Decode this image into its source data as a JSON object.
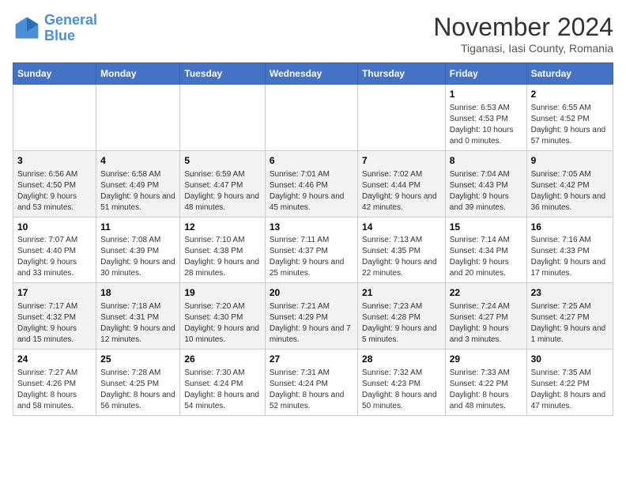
{
  "logo": {
    "line1": "General",
    "line2": "Blue"
  },
  "title": "November 2024",
  "subtitle": "Tiganasi, Iasi County, Romania",
  "days_of_week": [
    "Sunday",
    "Monday",
    "Tuesday",
    "Wednesday",
    "Thursday",
    "Friday",
    "Saturday"
  ],
  "weeks": [
    [
      {
        "day": "",
        "sunrise": "",
        "sunset": "",
        "daylight": ""
      },
      {
        "day": "",
        "sunrise": "",
        "sunset": "",
        "daylight": ""
      },
      {
        "day": "",
        "sunrise": "",
        "sunset": "",
        "daylight": ""
      },
      {
        "day": "",
        "sunrise": "",
        "sunset": "",
        "daylight": ""
      },
      {
        "day": "",
        "sunrise": "",
        "sunset": "",
        "daylight": ""
      },
      {
        "day": "1",
        "sunrise": "Sunrise: 6:53 AM",
        "sunset": "Sunset: 4:53 PM",
        "daylight": "Daylight: 10 hours and 0 minutes."
      },
      {
        "day": "2",
        "sunrise": "Sunrise: 6:55 AM",
        "sunset": "Sunset: 4:52 PM",
        "daylight": "Daylight: 9 hours and 57 minutes."
      }
    ],
    [
      {
        "day": "3",
        "sunrise": "Sunrise: 6:56 AM",
        "sunset": "Sunset: 4:50 PM",
        "daylight": "Daylight: 9 hours and 53 minutes."
      },
      {
        "day": "4",
        "sunrise": "Sunrise: 6:58 AM",
        "sunset": "Sunset: 4:49 PM",
        "daylight": "Daylight: 9 hours and 51 minutes."
      },
      {
        "day": "5",
        "sunrise": "Sunrise: 6:59 AM",
        "sunset": "Sunset: 4:47 PM",
        "daylight": "Daylight: 9 hours and 48 minutes."
      },
      {
        "day": "6",
        "sunrise": "Sunrise: 7:01 AM",
        "sunset": "Sunset: 4:46 PM",
        "daylight": "Daylight: 9 hours and 45 minutes."
      },
      {
        "day": "7",
        "sunrise": "Sunrise: 7:02 AM",
        "sunset": "Sunset: 4:44 PM",
        "daylight": "Daylight: 9 hours and 42 minutes."
      },
      {
        "day": "8",
        "sunrise": "Sunrise: 7:04 AM",
        "sunset": "Sunset: 4:43 PM",
        "daylight": "Daylight: 9 hours and 39 minutes."
      },
      {
        "day": "9",
        "sunrise": "Sunrise: 7:05 AM",
        "sunset": "Sunset: 4:42 PM",
        "daylight": "Daylight: 9 hours and 36 minutes."
      }
    ],
    [
      {
        "day": "10",
        "sunrise": "Sunrise: 7:07 AM",
        "sunset": "Sunset: 4:40 PM",
        "daylight": "Daylight: 9 hours and 33 minutes."
      },
      {
        "day": "11",
        "sunrise": "Sunrise: 7:08 AM",
        "sunset": "Sunset: 4:39 PM",
        "daylight": "Daylight: 9 hours and 30 minutes."
      },
      {
        "day": "12",
        "sunrise": "Sunrise: 7:10 AM",
        "sunset": "Sunset: 4:38 PM",
        "daylight": "Daylight: 9 hours and 28 minutes."
      },
      {
        "day": "13",
        "sunrise": "Sunrise: 7:11 AM",
        "sunset": "Sunset: 4:37 PM",
        "daylight": "Daylight: 9 hours and 25 minutes."
      },
      {
        "day": "14",
        "sunrise": "Sunrise: 7:13 AM",
        "sunset": "Sunset: 4:35 PM",
        "daylight": "Daylight: 9 hours and 22 minutes."
      },
      {
        "day": "15",
        "sunrise": "Sunrise: 7:14 AM",
        "sunset": "Sunset: 4:34 PM",
        "daylight": "Daylight: 9 hours and 20 minutes."
      },
      {
        "day": "16",
        "sunrise": "Sunrise: 7:16 AM",
        "sunset": "Sunset: 4:33 PM",
        "daylight": "Daylight: 9 hours and 17 minutes."
      }
    ],
    [
      {
        "day": "17",
        "sunrise": "Sunrise: 7:17 AM",
        "sunset": "Sunset: 4:32 PM",
        "daylight": "Daylight: 9 hours and 15 minutes."
      },
      {
        "day": "18",
        "sunrise": "Sunrise: 7:18 AM",
        "sunset": "Sunset: 4:31 PM",
        "daylight": "Daylight: 9 hours and 12 minutes."
      },
      {
        "day": "19",
        "sunrise": "Sunrise: 7:20 AM",
        "sunset": "Sunset: 4:30 PM",
        "daylight": "Daylight: 9 hours and 10 minutes."
      },
      {
        "day": "20",
        "sunrise": "Sunrise: 7:21 AM",
        "sunset": "Sunset: 4:29 PM",
        "daylight": "Daylight: 9 hours and 7 minutes."
      },
      {
        "day": "21",
        "sunrise": "Sunrise: 7:23 AM",
        "sunset": "Sunset: 4:28 PM",
        "daylight": "Daylight: 9 hours and 5 minutes."
      },
      {
        "day": "22",
        "sunrise": "Sunrise: 7:24 AM",
        "sunset": "Sunset: 4:27 PM",
        "daylight": "Daylight: 9 hours and 3 minutes."
      },
      {
        "day": "23",
        "sunrise": "Sunrise: 7:25 AM",
        "sunset": "Sunset: 4:27 PM",
        "daylight": "Daylight: 9 hours and 1 minute."
      }
    ],
    [
      {
        "day": "24",
        "sunrise": "Sunrise: 7:27 AM",
        "sunset": "Sunset: 4:26 PM",
        "daylight": "Daylight: 8 hours and 58 minutes."
      },
      {
        "day": "25",
        "sunrise": "Sunrise: 7:28 AM",
        "sunset": "Sunset: 4:25 PM",
        "daylight": "Daylight: 8 hours and 56 minutes."
      },
      {
        "day": "26",
        "sunrise": "Sunrise: 7:30 AM",
        "sunset": "Sunset: 4:24 PM",
        "daylight": "Daylight: 8 hours and 54 minutes."
      },
      {
        "day": "27",
        "sunrise": "Sunrise: 7:31 AM",
        "sunset": "Sunset: 4:24 PM",
        "daylight": "Daylight: 8 hours and 52 minutes."
      },
      {
        "day": "28",
        "sunrise": "Sunrise: 7:32 AM",
        "sunset": "Sunset: 4:23 PM",
        "daylight": "Daylight: 8 hours and 50 minutes."
      },
      {
        "day": "29",
        "sunrise": "Sunrise: 7:33 AM",
        "sunset": "Sunset: 4:22 PM",
        "daylight": "Daylight: 8 hours and 48 minutes."
      },
      {
        "day": "30",
        "sunrise": "Sunrise: 7:35 AM",
        "sunset": "Sunset: 4:22 PM",
        "daylight": "Daylight: 8 hours and 47 minutes."
      }
    ]
  ]
}
